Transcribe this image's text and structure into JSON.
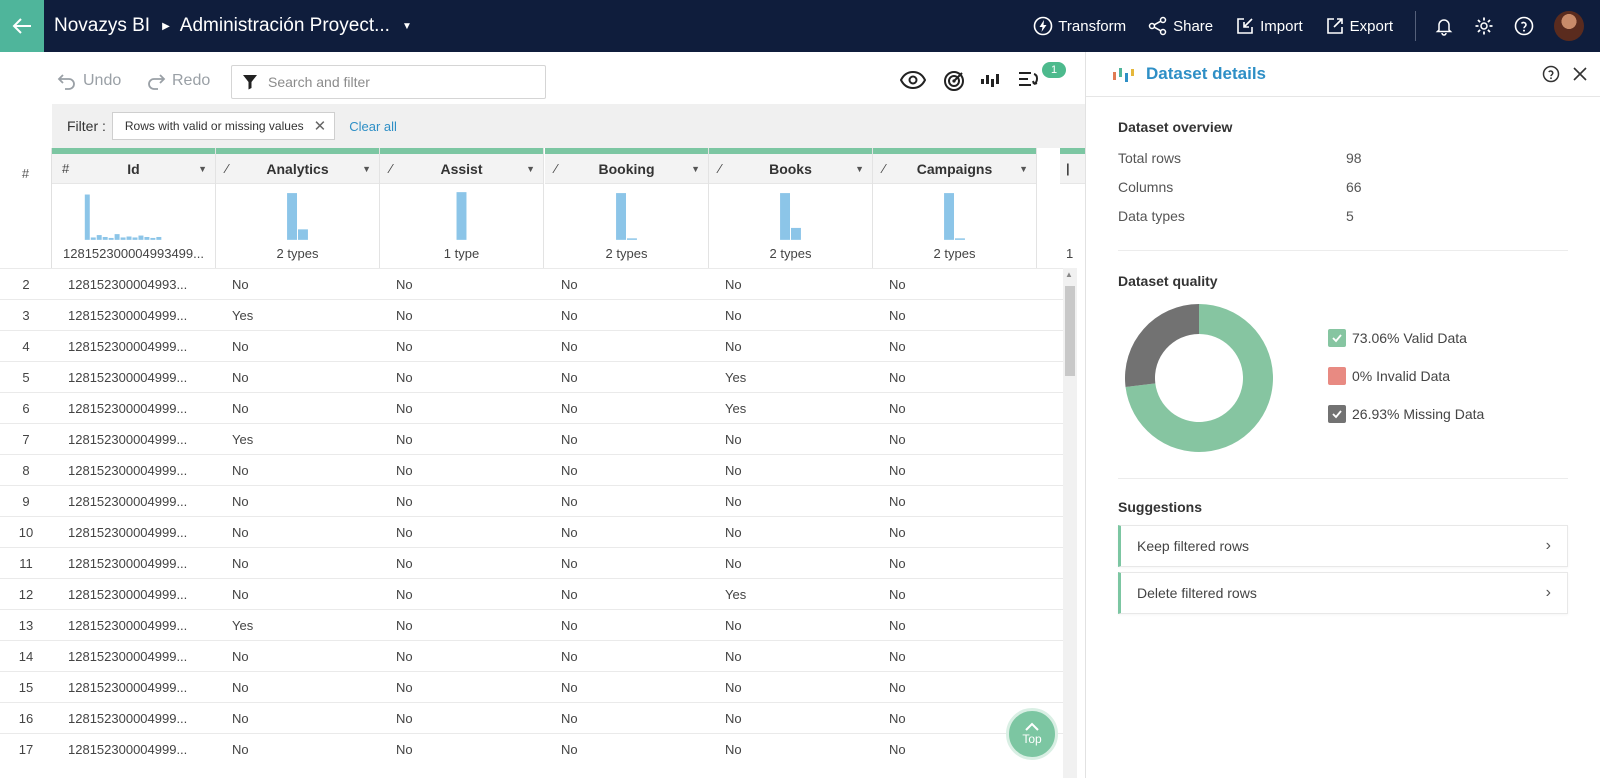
{
  "topbar": {
    "brand": "Novazys BI",
    "project": "Administración Proyect...",
    "actions": [
      {
        "label": "Transform",
        "icon": "lightning-icon"
      },
      {
        "label": "Share",
        "icon": "share-icon"
      },
      {
        "label": "Import",
        "icon": "import-icon"
      },
      {
        "label": "Export",
        "icon": "export-icon"
      }
    ]
  },
  "toolbar": {
    "undo_label": "Undo",
    "redo_label": "Redo",
    "search_placeholder": "Search and filter",
    "badge_count": "1"
  },
  "filter": {
    "label": "Filter :",
    "chip": "Rows with valid or missing values",
    "clear_all": "Clear all"
  },
  "grid": {
    "hash_label": "#",
    "columns": [
      {
        "name": "Id",
        "type_icon": "#",
        "summary": "128152300004993499...",
        "hist": [
          0.95,
          0.05,
          0.1,
          0.06,
          0.04,
          0.12,
          0.05,
          0.07,
          0.05,
          0.09,
          0.06,
          0.04,
          0.06
        ]
      },
      {
        "name": "Analytics",
        "type_icon": "⁄",
        "summary": "2 types",
        "hist": [
          0.98,
          0.22
        ]
      },
      {
        "name": "Assist",
        "type_icon": "⁄",
        "summary": "1 type",
        "hist": [
          1.0
        ]
      },
      {
        "name": "Booking",
        "type_icon": "⁄",
        "summary": "2 types",
        "hist": [
          0.98,
          0.03
        ]
      },
      {
        "name": "Books",
        "type_icon": "⁄",
        "summary": "2 types",
        "hist": [
          0.98,
          0.25
        ]
      },
      {
        "name": "Campaigns",
        "type_icon": "⁄",
        "summary": "2 types",
        "hist": [
          0.98,
          0.03
        ]
      }
    ],
    "partial_column_summary": "1",
    "rows": [
      {
        "n": "2",
        "id": "128152300004993...",
        "v": [
          "No",
          "No",
          "No",
          "No",
          "No"
        ]
      },
      {
        "n": "3",
        "id": "128152300004999...",
        "v": [
          "Yes",
          "No",
          "No",
          "No",
          "No"
        ]
      },
      {
        "n": "4",
        "id": "128152300004999...",
        "v": [
          "No",
          "No",
          "No",
          "No",
          "No"
        ]
      },
      {
        "n": "5",
        "id": "128152300004999...",
        "v": [
          "No",
          "No",
          "No",
          "Yes",
          "No"
        ]
      },
      {
        "n": "6",
        "id": "128152300004999...",
        "v": [
          "No",
          "No",
          "No",
          "Yes",
          "No"
        ]
      },
      {
        "n": "7",
        "id": "128152300004999...",
        "v": [
          "Yes",
          "No",
          "No",
          "No",
          "No"
        ]
      },
      {
        "n": "8",
        "id": "128152300004999...",
        "v": [
          "No",
          "No",
          "No",
          "No",
          "No"
        ]
      },
      {
        "n": "9",
        "id": "128152300004999...",
        "v": [
          "No",
          "No",
          "No",
          "No",
          "No"
        ]
      },
      {
        "n": "10",
        "id": "128152300004999...",
        "v": [
          "No",
          "No",
          "No",
          "No",
          "No"
        ]
      },
      {
        "n": "11",
        "id": "128152300004999...",
        "v": [
          "No",
          "No",
          "No",
          "No",
          "No"
        ]
      },
      {
        "n": "12",
        "id": "128152300004999...",
        "v": [
          "No",
          "No",
          "No",
          "Yes",
          "No"
        ]
      },
      {
        "n": "13",
        "id": "128152300004999...",
        "v": [
          "Yes",
          "No",
          "No",
          "No",
          "No"
        ]
      },
      {
        "n": "14",
        "id": "128152300004999...",
        "v": [
          "No",
          "No",
          "No",
          "No",
          "No"
        ]
      },
      {
        "n": "15",
        "id": "128152300004999...",
        "v": [
          "No",
          "No",
          "No",
          "No",
          "No"
        ]
      },
      {
        "n": "16",
        "id": "128152300004999...",
        "v": [
          "No",
          "No",
          "No",
          "No",
          "No"
        ]
      },
      {
        "n": "17",
        "id": "128152300004999...",
        "v": [
          "No",
          "No",
          "No",
          "No",
          "No"
        ]
      }
    ],
    "top_button": "Top"
  },
  "panel": {
    "title": "Dataset details",
    "overview_title": "Dataset overview",
    "overview": [
      {
        "key": "Total rows",
        "value": "98"
      },
      {
        "key": "Columns",
        "value": "66"
      },
      {
        "key": "Data types",
        "value": "5"
      }
    ],
    "quality_title": "Dataset quality",
    "quality": [
      {
        "label": "73.06% Valid Data",
        "value": 73.06,
        "color": "#86c5a1",
        "checked": true
      },
      {
        "label": "0% Invalid Data",
        "value": 0,
        "color": "#e88a82",
        "checked": false
      },
      {
        "label": "26.93% Missing Data",
        "value": 26.93,
        "color": "#727272",
        "checked": true
      }
    ],
    "suggestions_title": "Suggestions",
    "suggestions": [
      "Keep filtered rows",
      "Delete filtered rows"
    ]
  },
  "colors": {
    "topbar_bg": "#0f1d3c",
    "accent_green": "#7cc6a2",
    "link_blue": "#2e8fc6",
    "hist_blue": "#8cc5e8"
  }
}
